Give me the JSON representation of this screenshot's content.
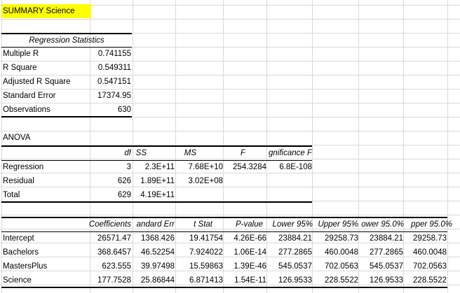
{
  "sheet": {
    "summary_title": "SUMMARY Science",
    "regression_stats": {
      "header": "Regression Statistics",
      "rows": [
        {
          "label": "Multiple R",
          "value": "0.741155"
        },
        {
          "label": "R Square",
          "value": "0.549311"
        },
        {
          "label": "Adjusted R Square",
          "value": "0.547151"
        },
        {
          "label": "Standard Error",
          "value": "17374.95"
        },
        {
          "label": "Observations",
          "value": "630"
        }
      ]
    },
    "anova": {
      "title": "ANOVA",
      "headers": [
        "df",
        "SS",
        "MS",
        "F",
        "gnificance F"
      ],
      "rows": [
        {
          "label": "Regression",
          "df": "3",
          "ss": "2.3E+11",
          "ms": "7.68E+10",
          "f": "254.3284",
          "sig": "6.8E-108"
        },
        {
          "label": "Residual",
          "df": "626",
          "ss": "1.89E+11",
          "ms": "3.02E+08",
          "f": "",
          "sig": ""
        },
        {
          "label": "Total",
          "df": "629",
          "ss": "4.19E+11",
          "ms": "",
          "f": "",
          "sig": ""
        }
      ]
    },
    "coefficients": {
      "headers": [
        "Coefficients",
        "andard Err",
        "t Stat",
        "P-value",
        "Lower 95%",
        "Upper 95%",
        "ower 95.0%",
        "pper 95.0%"
      ],
      "rows": [
        {
          "label": "Intercept",
          "values": [
            "26571.47",
            "1368.426",
            "19.41754",
            "4.26E-66",
            "23884.21",
            "29258.73",
            "23884.21",
            "29258.73"
          ]
        },
        {
          "label": "Bachelors",
          "values": [
            "368.6457",
            "46.52254",
            "7.924022",
            "1.06E-14",
            "277.2865",
            "460.0048",
            "277.2865",
            "460.0048"
          ]
        },
        {
          "label": "MastersPlus",
          "values": [
            "623.555",
            "39.97498",
            "15.59863",
            "1.39E-46",
            "545.0537",
            "702.0563",
            "545.0537",
            "702.0563"
          ]
        },
        {
          "label": "Science",
          "values": [
            "177.7528",
            "25.86844",
            "6.871413",
            "1.54E-11",
            "126.9533",
            "228.5522",
            "126.9533",
            "228.5522"
          ]
        }
      ]
    }
  },
  "colors": {
    "gridline": "#d9d9d9",
    "highlight": "#ffff00",
    "rule": "#000000"
  }
}
